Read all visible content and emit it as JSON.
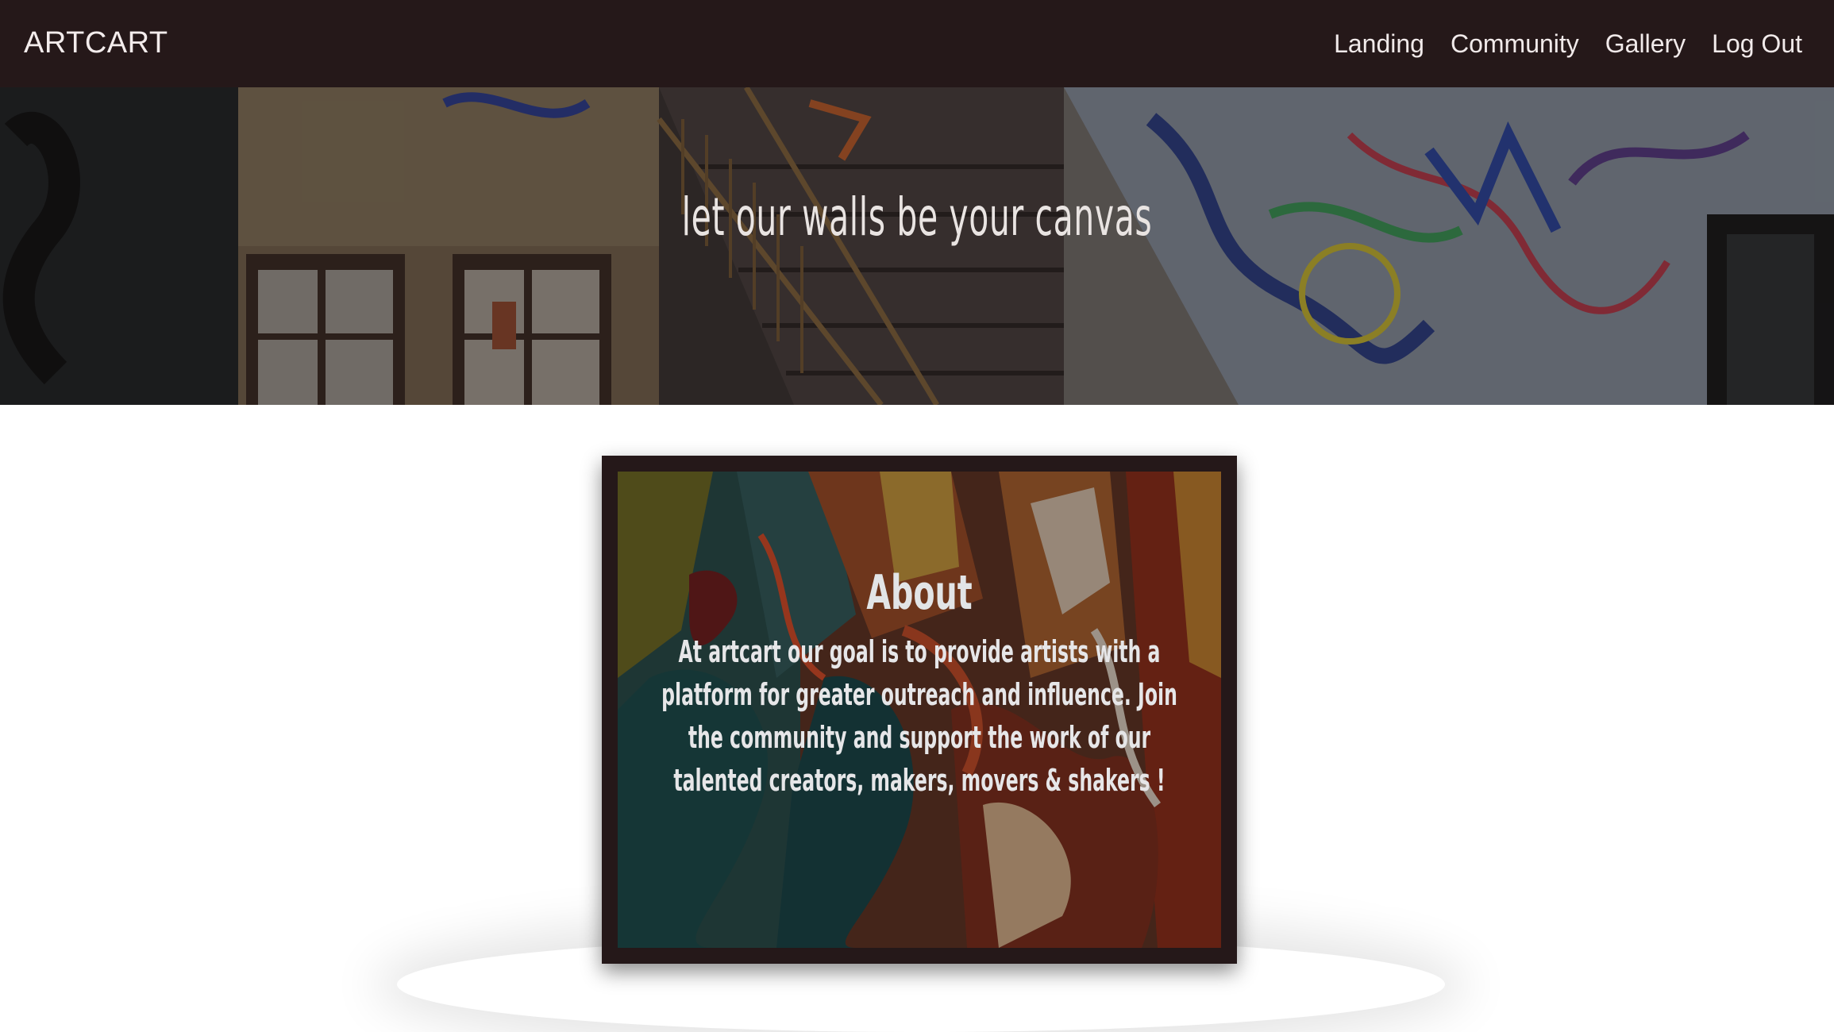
{
  "nav": {
    "brand": "ARTCART",
    "links": [
      "Landing",
      "Community",
      "Gallery",
      "Log Out"
    ]
  },
  "hero": {
    "title": "let our walls be your canvas"
  },
  "about": {
    "heading": "About",
    "text": "At artcart our goal is to provide artists with a platform for greater outreach and influence. Join the community and support the work of our talented creators, makers, movers & shakers !"
  },
  "colors": {
    "navbar": "#251819",
    "frame": "#251819",
    "text_light": "#f1eaea"
  }
}
